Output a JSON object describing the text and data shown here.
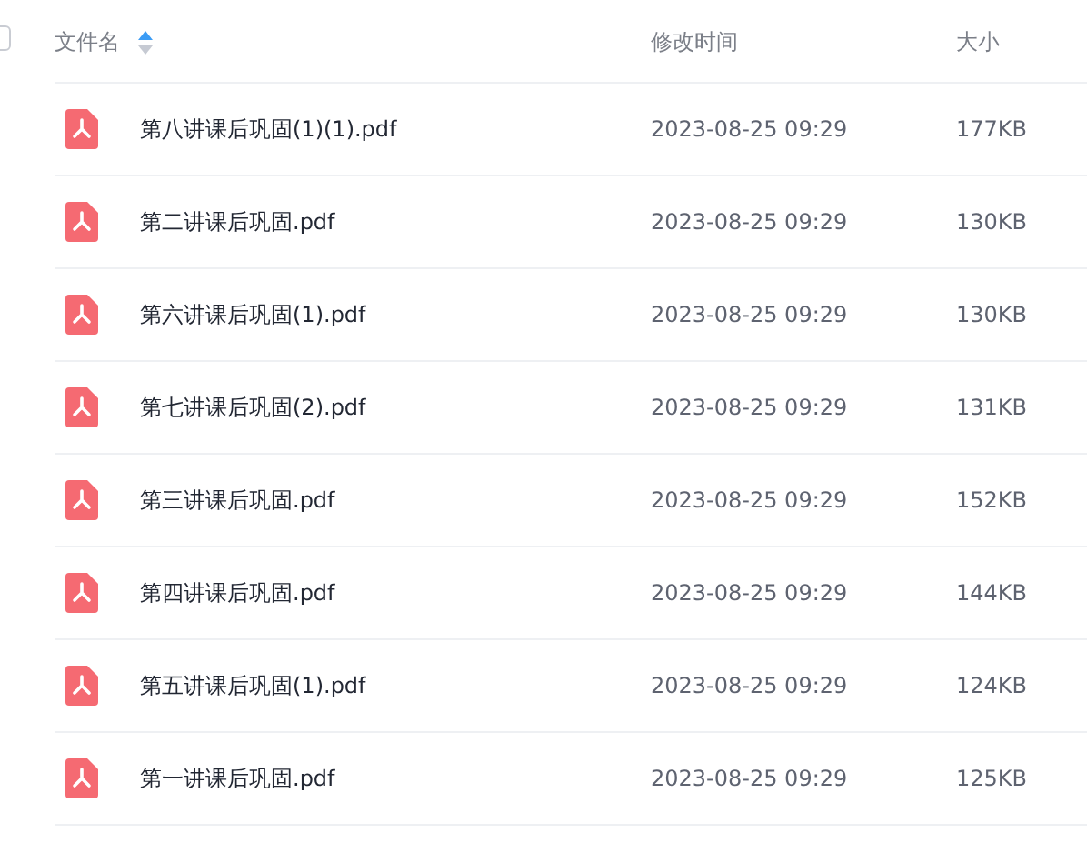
{
  "header": {
    "select_all": {
      "checked": false
    },
    "columns": [
      {
        "label": "文件名",
        "sorted_ascending": true
      },
      {
        "label": "修改时间"
      },
      {
        "label": "大小"
      }
    ]
  },
  "rows": [
    {
      "name": "第八讲课后巩固(1)(1).pdf",
      "modified": "2023-08-25 09:29",
      "size": "177KB"
    },
    {
      "name": "第二讲课后巩固.pdf",
      "modified": "2023-08-25 09:29",
      "size": "130KB"
    },
    {
      "name": "第六讲课后巩固(1).pdf",
      "modified": "2023-08-25 09:29",
      "size": "130KB"
    },
    {
      "name": "第七讲课后巩固(2).pdf",
      "modified": "2023-08-25 09:29",
      "size": "131KB"
    },
    {
      "name": "第三讲课后巩固.pdf",
      "modified": "2023-08-25 09:29",
      "size": "152KB"
    },
    {
      "name": "第四讲课后巩固.pdf",
      "modified": "2023-08-25 09:29",
      "size": "144KB"
    },
    {
      "name": "第五讲课后巩固(1).pdf",
      "modified": "2023-08-25 09:29",
      "size": "124KB"
    },
    {
      "name": "第一讲课后巩固.pdf",
      "modified": "2023-08-25 09:29",
      "size": "125KB"
    }
  ]
}
